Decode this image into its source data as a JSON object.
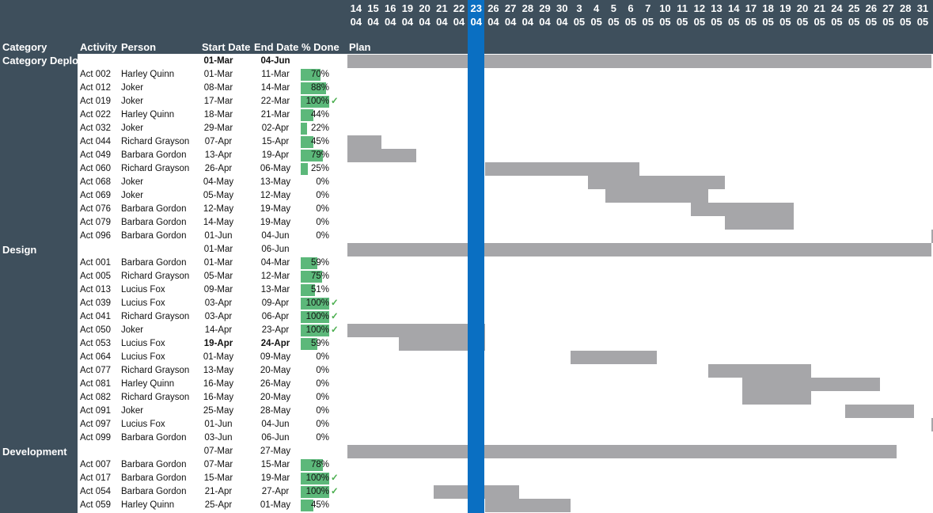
{
  "headers": {
    "category": "Category",
    "activity": "Activity",
    "person": "Person",
    "start_date": "Start Date",
    "end_date": "End Date",
    "done": "% Done",
    "plan": "Plan"
  },
  "timeline": {
    "days": [
      "14",
      "15",
      "16",
      "19",
      "20",
      "21",
      "22",
      "23",
      "26",
      "27",
      "28",
      "29",
      "30",
      "3",
      "4",
      "5",
      "6",
      "7",
      "10",
      "11",
      "12",
      "13",
      "14",
      "17",
      "18",
      "19",
      "20",
      "21",
      "24",
      "25",
      "26",
      "27",
      "28",
      "31"
    ],
    "months": [
      "04",
      "04",
      "04",
      "04",
      "04",
      "04",
      "04",
      "04",
      "04",
      "04",
      "04",
      "04",
      "04",
      "05",
      "05",
      "05",
      "05",
      "05",
      "05",
      "05",
      "05",
      "05",
      "05",
      "05",
      "05",
      "05",
      "05",
      "05",
      "05",
      "05",
      "05",
      "05",
      "05",
      "05"
    ],
    "today_index": 7
  },
  "rows": [
    {
      "type": "category",
      "category": "Category Deployment",
      "start": "01-Mar",
      "end": "04-Jun",
      "bold": true,
      "bar": [
        0,
        34
      ]
    },
    {
      "activity": "Act 002",
      "person": "Harley Quinn",
      "start": "01-Mar",
      "end": "11-Mar",
      "done": "70%",
      "pct": 70
    },
    {
      "activity": "Act 012",
      "person": "Joker",
      "start": "08-Mar",
      "end": "14-Mar",
      "done": "88%",
      "pct": 88
    },
    {
      "activity": "Act 019",
      "person": "Joker",
      "start": "17-Mar",
      "end": "22-Mar",
      "done": "100%",
      "pct": 100,
      "check": "✓"
    },
    {
      "activity": "Act 022",
      "person": "Harley Quinn",
      "start": "18-Mar",
      "end": "21-Mar",
      "done": "44%",
      "pct": 44
    },
    {
      "activity": "Act 032",
      "person": "Joker",
      "start": "29-Mar",
      "end": "02-Apr",
      "done": "22%",
      "pct": 22
    },
    {
      "activity": "Act 044",
      "person": "Richard Grayson",
      "start": "07-Apr",
      "end": "15-Apr",
      "done": "45%",
      "pct": 45,
      "bar": [
        0,
        2
      ]
    },
    {
      "activity": "Act 049",
      "person": "Barbara Gordon",
      "start": "13-Apr",
      "end": "19-Apr",
      "done": "79%",
      "pct": 79,
      "bar": [
        0,
        4
      ]
    },
    {
      "activity": "Act 060",
      "person": "Richard Grayson",
      "start": "26-Apr",
      "end": "06-May",
      "done": "25%",
      "pct": 25,
      "bar": [
        8,
        17
      ]
    },
    {
      "activity": "Act 068",
      "person": "Joker",
      "start": "04-May",
      "end": "13-May",
      "done": "0%",
      "pct": 0,
      "bar": [
        14,
        22
      ]
    },
    {
      "activity": "Act 069",
      "person": "Joker",
      "start": "05-May",
      "end": "12-May",
      "done": "0%",
      "pct": 0,
      "bar": [
        15,
        21
      ]
    },
    {
      "activity": "Act 076",
      "person": "Barbara Gordon",
      "start": "12-May",
      "end": "19-May",
      "done": "0%",
      "pct": 0,
      "bar": [
        20,
        26
      ]
    },
    {
      "activity": "Act 079",
      "person": "Barbara Gordon",
      "start": "14-May",
      "end": "19-May",
      "done": "0%",
      "pct": 0,
      "bar": [
        22,
        26
      ]
    },
    {
      "activity": "Act 096",
      "person": "Barbara Gordon",
      "start": "01-Jun",
      "end": "04-Jun",
      "done": "0%",
      "pct": 0,
      "bar": [
        34,
        34
      ]
    },
    {
      "type": "category",
      "category": "Design",
      "start": "01-Mar",
      "end": "06-Jun",
      "bold": false,
      "bar": [
        0,
        34
      ]
    },
    {
      "activity": "Act 001",
      "person": "Barbara Gordon",
      "start": "01-Mar",
      "end": "04-Mar",
      "done": "59%",
      "pct": 59
    },
    {
      "activity": "Act 005",
      "person": "Richard Grayson",
      "start": "05-Mar",
      "end": "12-Mar",
      "done": "75%",
      "pct": 75
    },
    {
      "activity": "Act 013",
      "person": "Lucius Fox",
      "start": "09-Mar",
      "end": "13-Mar",
      "done": "51%",
      "pct": 51
    },
    {
      "activity": "Act 039",
      "person": "Lucius Fox",
      "start": "03-Apr",
      "end": "09-Apr",
      "done": "100%",
      "pct": 100,
      "check": "✓"
    },
    {
      "activity": "Act 041",
      "person": "Richard Grayson",
      "start": "03-Apr",
      "end": "06-Apr",
      "done": "100%",
      "pct": 100,
      "check": "✓"
    },
    {
      "activity": "Act 050",
      "person": "Joker",
      "start": "14-Apr",
      "end": "23-Apr",
      "done": "100%",
      "pct": 100,
      "check": "✓",
      "bar": [
        0,
        8
      ]
    },
    {
      "activity": "Act 053",
      "person": "Lucius Fox",
      "start": "19-Apr",
      "end": "24-Apr",
      "done": "59%",
      "pct": 59,
      "bold": true,
      "bar": [
        3,
        8
      ]
    },
    {
      "activity": "Act 064",
      "person": "Lucius Fox",
      "start": "01-May",
      "end": "09-May",
      "done": "0%",
      "pct": 0,
      "bar": [
        13,
        18
      ]
    },
    {
      "activity": "Act 077",
      "person": "Richard Grayson",
      "start": "13-May",
      "end": "20-May",
      "done": "0%",
      "pct": 0,
      "bar": [
        21,
        27
      ]
    },
    {
      "activity": "Act 081",
      "person": "Harley Quinn",
      "start": "16-May",
      "end": "26-May",
      "done": "0%",
      "pct": 0,
      "bar": [
        23,
        31
      ]
    },
    {
      "activity": "Act 082",
      "person": "Richard Grayson",
      "start": "16-May",
      "end": "20-May",
      "done": "0%",
      "pct": 0,
      "bar": [
        23,
        27
      ]
    },
    {
      "activity": "Act 091",
      "person": "Joker",
      "start": "25-May",
      "end": "28-May",
      "done": "0%",
      "pct": 0,
      "bar": [
        29,
        33
      ]
    },
    {
      "activity": "Act 097",
      "person": "Lucius Fox",
      "start": "01-Jun",
      "end": "04-Jun",
      "done": "0%",
      "pct": 0,
      "bar": [
        34,
        34
      ]
    },
    {
      "activity": "Act 099",
      "person": "Barbara Gordon",
      "start": "03-Jun",
      "end": "06-Jun",
      "done": "0%",
      "pct": 0
    },
    {
      "type": "category",
      "category": "Development",
      "start": "07-Mar",
      "end": "27-May",
      "bold": false,
      "bar": [
        0,
        32
      ]
    },
    {
      "activity": "Act 007",
      "person": "Barbara Gordon",
      "start": "07-Mar",
      "end": "15-Mar",
      "done": "78%",
      "pct": 78
    },
    {
      "activity": "Act 017",
      "person": "Barbara Gordon",
      "start": "15-Mar",
      "end": "19-Mar",
      "done": "100%",
      "pct": 100,
      "check": "✓"
    },
    {
      "activity": "Act 054",
      "person": "Barbara Gordon",
      "start": "21-Apr",
      "end": "27-Apr",
      "done": "100%",
      "pct": 100,
      "check": "✓",
      "bar": [
        5,
        10
      ]
    },
    {
      "activity": "Act 059",
      "person": "Harley Quinn",
      "start": "25-Apr",
      "end": "01-May",
      "done": "45%",
      "pct": 45,
      "bar": [
        8,
        13
      ]
    }
  ]
}
